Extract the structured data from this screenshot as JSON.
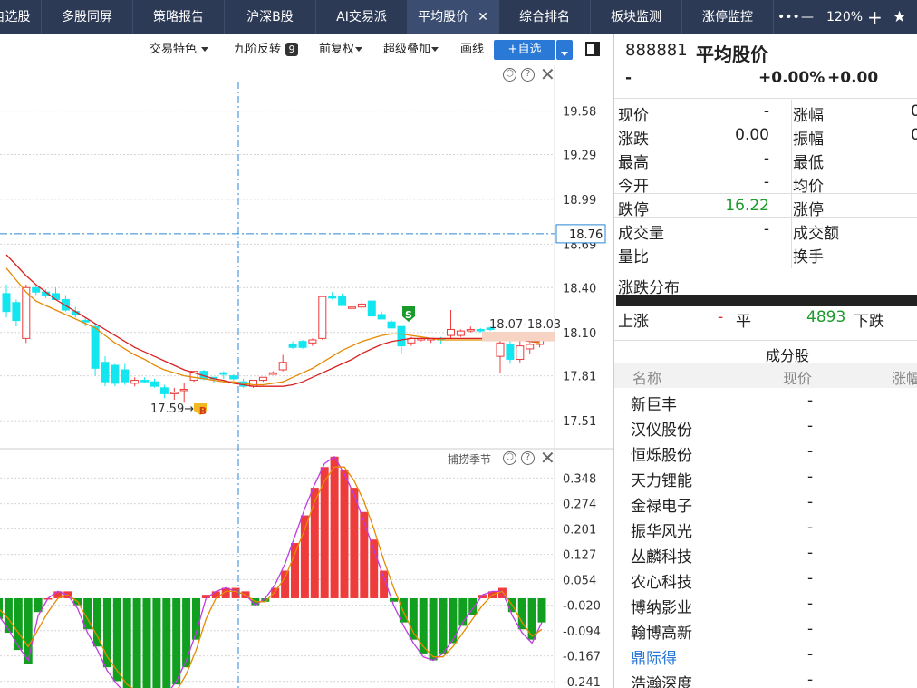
{
  "tabs": [
    {
      "label": "自选股"
    },
    {
      "label": "多股同屏"
    },
    {
      "label": "策略报告"
    },
    {
      "label": "沪深B股"
    },
    {
      "label": "AI交易派"
    },
    {
      "label": "平均股价",
      "active": true,
      "close": "✕"
    },
    {
      "label": "综合排名"
    },
    {
      "label": "板块监测"
    },
    {
      "label": "涨停监控"
    }
  ],
  "topright": {
    "more": "•••",
    "minus": "—",
    "zoom": "120%",
    "plus": "+",
    "star": "★"
  },
  "toolbar": {
    "trade_feature": "交易特色",
    "nine_reversal": "九阶反转",
    "nine_badge": "9",
    "adjust": "前复权",
    "overlay": "超级叠加",
    "draw": "画线",
    "add_watch": "+自选"
  },
  "chart": {
    "cursor_price": "18.76",
    "price_ticks": [
      "19.58",
      "19.29",
      "18.99",
      "18.69",
      "18.40",
      "18.10",
      "17.81",
      "17.51"
    ],
    "low_label": "17.59→",
    "range_label": "18.07-18.03",
    "buy_marker": "B",
    "sell_marker": "S",
    "indicator_name": "捕捞季节",
    "ind_ticks": [
      "0.348",
      "0.274",
      "0.201",
      "0.127",
      "0.054",
      "-0.020",
      "-0.094",
      "-0.167",
      "-0.241"
    ],
    "colors": {
      "up": "#ee3b3b",
      "down": "#14e6f0",
      "ind_up": "#ee3b3b",
      "ind_down": "#119f1f",
      "ma_red": "#d92121",
      "ma_orange": "#e58a00",
      "cursor": "#2a86d8"
    }
  },
  "chart_data": {
    "type": "candlestick",
    "ylim": [
      17.45,
      19.62
    ],
    "candles": [
      [
        18.36,
        18.42,
        18.2,
        18.24
      ],
      [
        18.3,
        18.32,
        18.14,
        18.18
      ],
      [
        18.06,
        18.42,
        18.03,
        18.4
      ],
      [
        18.4,
        18.41,
        18.35,
        18.37
      ],
      [
        18.37,
        18.39,
        18.33,
        18.35
      ],
      [
        18.36,
        18.4,
        18.32,
        18.32
      ],
      [
        18.32,
        18.35,
        18.24,
        18.25
      ],
      [
        18.24,
        18.27,
        18.2,
        18.22
      ],
      [
        18.18,
        18.2,
        18.14,
        18.17
      ],
      [
        18.14,
        18.16,
        17.81,
        17.86
      ],
      [
        17.9,
        17.94,
        17.74,
        17.77
      ],
      [
        17.88,
        17.89,
        17.74,
        17.76
      ],
      [
        17.85,
        17.89,
        17.75,
        17.77
      ],
      [
        17.76,
        17.8,
        17.74,
        17.78
      ],
      [
        17.78,
        17.8,
        17.76,
        17.77
      ],
      [
        17.77,
        17.79,
        17.73,
        17.74
      ],
      [
        17.73,
        17.75,
        17.66,
        17.69
      ],
      [
        17.69,
        17.73,
        17.65,
        17.7
      ],
      [
        17.72,
        17.76,
        17.63,
        17.72
      ],
      [
        17.78,
        17.84,
        17.77,
        17.84
      ],
      [
        17.84,
        17.85,
        17.78,
        17.79
      ],
      [
        17.8,
        17.8,
        17.76,
        17.79
      ],
      [
        17.83,
        17.84,
        17.79,
        17.82
      ],
      [
        17.81,
        17.82,
        17.78,
        17.79
      ],
      [
        17.77,
        17.79,
        17.73,
        17.74
      ],
      [
        17.74,
        17.78,
        17.73,
        17.78
      ],
      [
        17.78,
        17.8,
        17.77,
        17.8
      ],
      [
        17.82,
        17.84,
        17.82,
        17.83
      ],
      [
        17.85,
        17.95,
        17.84,
        17.9
      ],
      [
        18.02,
        18.04,
        17.99,
        18.0
      ],
      [
        18.04,
        18.05,
        17.99,
        18.0
      ],
      [
        18.03,
        18.06,
        18.01,
        18.05
      ],
      [
        18.06,
        18.34,
        18.05,
        18.34
      ],
      [
        18.34,
        18.37,
        18.32,
        18.33
      ],
      [
        18.34,
        18.36,
        18.28,
        18.28
      ],
      [
        18.27,
        18.28,
        18.26,
        18.27
      ],
      [
        18.27,
        18.33,
        18.26,
        18.29
      ],
      [
        18.31,
        18.32,
        18.21,
        18.21
      ],
      [
        18.22,
        18.24,
        18.19,
        18.19
      ],
      [
        18.17,
        18.18,
        18.13,
        18.13
      ],
      [
        18.14,
        18.14,
        17.96,
        18.01
      ],
      [
        18.03,
        18.07,
        18.01,
        18.06
      ],
      [
        18.05,
        18.06,
        18.04,
        18.06
      ],
      [
        18.05,
        18.06,
        18.03,
        18.06
      ],
      [
        18.06,
        18.07,
        18.02,
        18.05
      ],
      [
        18.08,
        18.25,
        18.06,
        18.12
      ],
      [
        18.08,
        18.12,
        18.07,
        18.11
      ],
      [
        18.11,
        18.14,
        18.1,
        18.12
      ],
      [
        18.12,
        18.13,
        18.1,
        18.11
      ],
      [
        18.13,
        18.14,
        18.11,
        18.12
      ],
      [
        17.94,
        18.06,
        17.83,
        18.03
      ],
      [
        18.02,
        18.05,
        17.89,
        17.92
      ],
      [
        17.92,
        18.05,
        17.9,
        18.01
      ],
      [
        17.99,
        18.03,
        17.96,
        18.02
      ],
      [
        18.02,
        18.06,
        18.0,
        18.06
      ]
    ],
    "ma_fast": [
      18.53,
      18.45,
      18.37,
      18.31,
      18.28,
      18.25,
      18.22,
      18.19,
      18.16,
      18.13,
      18.08,
      18.03,
      17.99,
      17.95,
      17.92,
      17.88,
      17.85,
      17.83,
      17.81,
      17.8,
      17.79,
      17.78,
      17.77,
      17.77,
      17.76,
      17.75,
      17.75,
      17.76,
      17.77,
      17.8,
      17.83,
      17.86,
      17.9,
      17.94,
      17.98,
      18.01,
      18.04,
      18.06,
      18.08,
      18.09,
      18.09,
      18.08,
      18.07,
      18.06,
      18.05,
      18.05,
      18.05,
      18.05,
      18.05,
      18.05,
      18.05,
      18.05,
      18.05,
      18.04,
      18.03
    ],
    "ma_slow": [
      18.62,
      18.55,
      18.48,
      18.42,
      18.37,
      18.32,
      18.28,
      18.24,
      18.2,
      18.16,
      18.12,
      18.08,
      18.04,
      18.0,
      17.97,
      17.94,
      17.91,
      17.88,
      17.85,
      17.83,
      17.81,
      17.79,
      17.78,
      17.76,
      17.75,
      17.74,
      17.74,
      17.74,
      17.74,
      17.75,
      17.77,
      17.8,
      17.83,
      17.86,
      17.89,
      17.92,
      17.96,
      17.99,
      18.02,
      18.04,
      18.05,
      18.06,
      18.06,
      18.06,
      18.06,
      18.06,
      18.06,
      18.06,
      18.06,
      18.06,
      18.06,
      18.05,
      18.05,
      18.04,
      18.04
    ],
    "indicator": {
      "name": "捕捞季节",
      "ylim": [
        -0.26,
        0.42
      ],
      "bars": [
        -0.06,
        -0.1,
        -0.15,
        -0.19,
        -0.04,
        0.0,
        0.02,
        0.02,
        -0.02,
        -0.09,
        -0.14,
        -0.2,
        -0.24,
        -0.28,
        -0.29,
        -0.3,
        -0.3,
        -0.29,
        -0.25,
        -0.2,
        -0.12,
        0.01,
        0.02,
        0.03,
        0.03,
        0.02,
        -0.02,
        -0.01,
        0.03,
        0.08,
        0.16,
        0.24,
        0.32,
        0.38,
        0.41,
        0.37,
        0.32,
        0.25,
        0.17,
        0.08,
        -0.01,
        -0.07,
        -0.12,
        -0.16,
        -0.18,
        -0.16,
        -0.13,
        -0.08,
        -0.05,
        0.01,
        0.02,
        0.03,
        -0.04,
        -0.09,
        -0.12,
        -0.07
      ],
      "diff": [
        -0.05,
        -0.09,
        -0.14,
        -0.18,
        -0.05,
        0.0,
        0.02,
        0.01,
        -0.03,
        -0.1,
        -0.15,
        -0.21,
        -0.25,
        -0.28,
        -0.29,
        -0.3,
        -0.3,
        -0.28,
        -0.24,
        -0.18,
        -0.1,
        0.0,
        0.02,
        0.03,
        0.02,
        0.01,
        -0.02,
        0.0,
        0.04,
        0.1,
        0.18,
        0.26,
        0.33,
        0.39,
        0.41,
        0.36,
        0.3,
        0.22,
        0.14,
        0.06,
        -0.02,
        -0.08,
        -0.13,
        -0.17,
        -0.18,
        -0.16,
        -0.12,
        -0.07,
        -0.03,
        0.01,
        0.02,
        0.02,
        -0.05,
        -0.1,
        -0.13,
        -0.07
      ],
      "dea": [
        -0.03,
        -0.06,
        -0.1,
        -0.14,
        -0.09,
        -0.04,
        0.0,
        0.01,
        -0.01,
        -0.06,
        -0.11,
        -0.17,
        -0.21,
        -0.25,
        -0.27,
        -0.29,
        -0.29,
        -0.29,
        -0.27,
        -0.22,
        -0.15,
        -0.06,
        0.0,
        0.02,
        0.02,
        0.01,
        -0.01,
        -0.01,
        0.02,
        0.06,
        0.13,
        0.2,
        0.28,
        0.34,
        0.38,
        0.38,
        0.34,
        0.28,
        0.2,
        0.11,
        0.03,
        -0.04,
        -0.1,
        -0.14,
        -0.17,
        -0.17,
        -0.14,
        -0.1,
        -0.06,
        -0.02,
        0.01,
        0.02,
        -0.02,
        -0.07,
        -0.11,
        -0.09
      ]
    }
  },
  "quote": {
    "code": "888881",
    "name": "平均股价",
    "price_dash": "-",
    "chg_pct": "+0.00%",
    "chg": "+0.00",
    "rows": [
      {
        "l1": "现价",
        "v1": "-",
        "l2": "涨幅",
        "v2": "0"
      },
      {
        "l1": "涨跌",
        "v1": "0.00",
        "l2": "振幅",
        "v2": "0"
      },
      {
        "l1": "最高",
        "v1": "-",
        "l2": "最低",
        "v2": ""
      },
      {
        "l1": "今开",
        "v1": "-",
        "l2": "均价",
        "v2": ""
      },
      {
        "l1": "跌停",
        "v1": "16.22",
        "l2": "涨停",
        "v2": ""
      },
      {
        "l1": "成交量",
        "v1": "-",
        "l2": "成交额",
        "v2": ""
      },
      {
        "l1": "量比",
        "v1": "",
        "l2": "换手",
        "v2": ""
      }
    ],
    "dist_title": "涨跌分布",
    "dist": {
      "up_label": "上涨",
      "up_val": "-",
      "flat_label": "平",
      "flat_val": "4893",
      "down_label": "下跌"
    },
    "constituents_title": "成分股",
    "cols": {
      "name": "名称",
      "price": "现价",
      "pct": "涨幅"
    },
    "stocks": [
      {
        "name": "新巨丰",
        "price": "-"
      },
      {
        "name": "汉仪股份",
        "price": "-"
      },
      {
        "name": "恒烁股份",
        "price": "-"
      },
      {
        "name": "天力锂能",
        "price": "-"
      },
      {
        "name": "金禄电子",
        "price": "-"
      },
      {
        "name": "振华风光",
        "price": "-"
      },
      {
        "name": "丛麟科技",
        "price": "-"
      },
      {
        "name": "农心科技",
        "price": "-"
      },
      {
        "name": "博纳影业",
        "price": "-"
      },
      {
        "name": "翰博高新",
        "price": "-"
      },
      {
        "name": "鼎际得",
        "price": "-",
        "highlight": true
      },
      {
        "name": "浩瀚深度",
        "price": "-"
      }
    ]
  }
}
